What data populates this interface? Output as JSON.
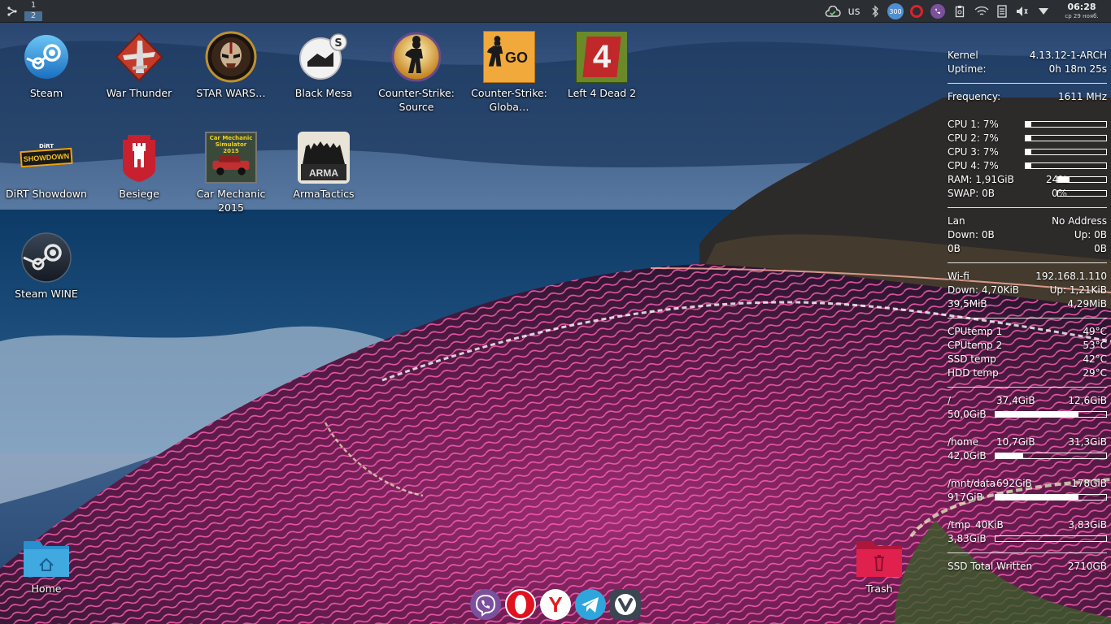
{
  "panel": {
    "pager": [
      "1",
      "2"
    ],
    "layout": "us",
    "tray_icons": [
      "cloud-icon",
      "bluetooth-icon",
      "counter-badge-icon",
      "opera-tray-icon",
      "viber-tray-icon",
      "clipboard-icon",
      "wifi-icon",
      "notes-icon",
      "volume-icon",
      "arrow-down-icon"
    ],
    "tray_badge": "300",
    "clock_time": "06:28",
    "clock_date": "ср 29 нояб."
  },
  "desktop": {
    "icons": [
      {
        "label": "Steam"
      },
      {
        "label": "War Thunder"
      },
      {
        "label": "STAR WARS…"
      },
      {
        "label": "Black Mesa"
      },
      {
        "label": "Counter-Strike: Source"
      },
      {
        "label": "Counter-Strike: Globa…"
      },
      {
        "label": "Left 4 Dead 2"
      },
      {
        "label": "DiRT Showdown"
      },
      {
        "label": "Besiege"
      },
      {
        "label": "Car Mechanic 2015"
      },
      {
        "label": "ArmaTactics"
      },
      {
        "label": "Steam WINE"
      }
    ],
    "home_label": "Home",
    "trash_label": "Trash",
    "logo_texts": {
      "go": "GO",
      "l4d": "4",
      "dirt_small": "DiRT",
      "dirt": "SHOWDOWN",
      "car": "Car Mechanic Simulator 2015",
      "arma": "ARMA"
    }
  },
  "conky": {
    "kernel_label": "Kernel",
    "kernel": "4.13.12-1-ARCH",
    "uptime_label": "Uptime:",
    "uptime": "0h 18m 25s",
    "freq_label": "Frequency:",
    "freq": "1611 MHz",
    "cpus": [
      {
        "label": "CPU 1: 7%",
        "pct": 7
      },
      {
        "label": "CPU 2: 7%",
        "pct": 7
      },
      {
        "label": "CPU 3: 7%",
        "pct": 7
      },
      {
        "label": "CPU 4: 7%",
        "pct": 7
      }
    ],
    "ram_label": "RAM: 1,91GiB",
    "ram_pct": "24%",
    "ram_val": 24,
    "swap_label": "SWAP: 0B",
    "swap_pct": "0%",
    "swap_val": 0,
    "lan": {
      "label": "Lan",
      "addr": "No Address",
      "down": "Down: 0B",
      "up": "Up: 0B",
      "total_down": "0B",
      "total_up": "0B"
    },
    "wifi": {
      "label": "Wi-fi",
      "addr": "192.168.1.110",
      "down": "Down: 4,70KiB",
      "up": "Up: 1,21KiB",
      "total_down": "39,5MiB",
      "total_up": "4,29MiB"
    },
    "temps": [
      {
        "label": "CPUtemp 1",
        "value": "49°C"
      },
      {
        "label": "CPUtemp 2",
        "value": "53°C"
      },
      {
        "label": "SSD temp",
        "value": "42°C"
      },
      {
        "label": "HDD temp",
        "value": "29°C"
      }
    ],
    "disks": [
      {
        "mount": "/",
        "used": "37,4GiB",
        "free": "12,6GiB",
        "size": "50,0GiB",
        "pct": 75
      },
      {
        "mount": "/home",
        "used": "10,7GiB",
        "free": "31,3GiB",
        "size": "42,0GiB",
        "pct": 25
      },
      {
        "mount": "/mnt/data",
        "used": "692GiB",
        "free": "178GiB",
        "size": "917GiB",
        "pct": 75
      },
      {
        "mount": "/tmp",
        "used": "40KiB",
        "free": "3,83GiB",
        "size": "3,83GiB",
        "pct": 0
      }
    ],
    "ssd_written_label": "SSD Total Written",
    "ssd_written": "2710GB"
  },
  "dock": {
    "apps": [
      "viber-icon",
      "opera-icon",
      "yandex-browser-icon",
      "telegram-icon",
      "vivaldi-icon"
    ],
    "yandex_letter": "Y"
  },
  "colors": {
    "panel": "#2b2e33",
    "folder_home": "#3fa9e0",
    "folder_trash": "#e0204d"
  }
}
